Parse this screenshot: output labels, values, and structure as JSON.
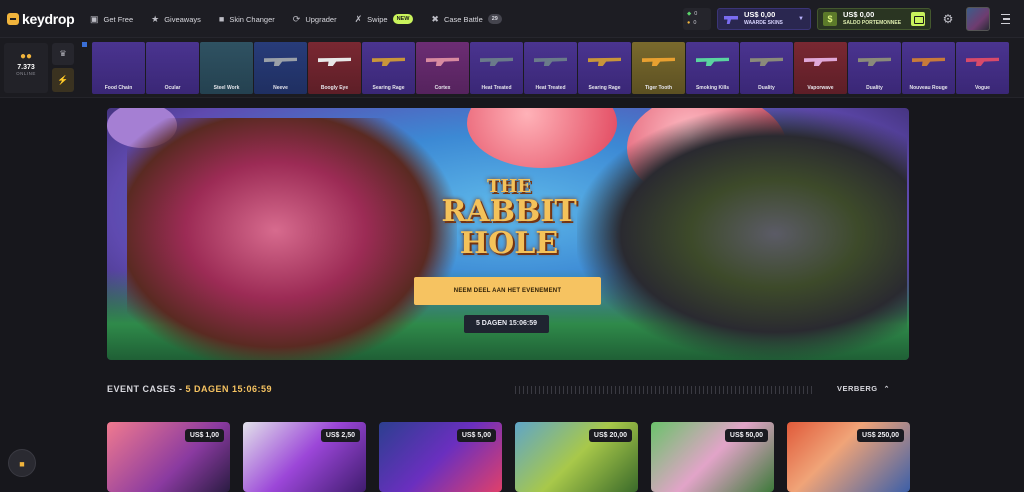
{
  "brand": {
    "name": "keydrop"
  },
  "nav": [
    {
      "label": "Get Free",
      "icon": "gift-icon"
    },
    {
      "label": "Giveaways",
      "icon": "giveaway-icon"
    },
    {
      "label": "Skin Changer",
      "icon": "skin-changer-icon"
    },
    {
      "label": "Upgrader",
      "icon": "upgrader-icon"
    },
    {
      "label": "Swipe",
      "icon": "swipe-icon",
      "badge": "NEW"
    },
    {
      "label": "Case Battle",
      "icon": "case-battle-icon",
      "badge": "29"
    }
  ],
  "gems": {
    "green": "0",
    "gold": "0"
  },
  "skins_balance": {
    "value": "US$ 0,00",
    "label": "WAARDE SKINS"
  },
  "wallet": {
    "value": "US$ 0,00",
    "label": "SALDO PORTEMONNEE"
  },
  "online": {
    "count": "7.373",
    "label": "ONLINE"
  },
  "live_drops": [
    {
      "name": "Food Chain",
      "rarity": "purple",
      "skin": false
    },
    {
      "name": "Ocular",
      "rarity": "purple",
      "skin": false
    },
    {
      "name": "Steel Work",
      "rarity": "steel",
      "skin": false
    },
    {
      "name": "Neeve",
      "rarity": "blue",
      "skin": true,
      "color": "#9aa0a8"
    },
    {
      "name": "Boogly Eye",
      "rarity": "red",
      "skin": true,
      "color": "#e8e8e8"
    },
    {
      "name": "Searing Rage",
      "rarity": "purple",
      "skin": true,
      "color": "#c8953a"
    },
    {
      "name": "Cortex",
      "rarity": "pink",
      "skin": true,
      "color": "#d88aa0"
    },
    {
      "name": "Heat Treated",
      "rarity": "purple",
      "skin": true,
      "color": "#6a7a8a"
    },
    {
      "name": "Heat Treated",
      "rarity": "purple",
      "skin": true,
      "color": "#6a7a8a"
    },
    {
      "name": "Searing Rage",
      "rarity": "purple",
      "skin": true,
      "color": "#c8953a"
    },
    {
      "name": "Tiger Tooth",
      "rarity": "gold",
      "skin": true,
      "color": "#e8a030"
    },
    {
      "name": "Smoking Kills",
      "rarity": "purple",
      "skin": true,
      "color": "#5ad4a0"
    },
    {
      "name": "Duality",
      "rarity": "purple",
      "skin": true,
      "color": "#8a8a7a"
    },
    {
      "name": "Vaporwave",
      "rarity": "red",
      "skin": true,
      "color": "#e0a8d8"
    },
    {
      "name": "Duality",
      "rarity": "purple",
      "skin": true,
      "color": "#8a8a7a"
    },
    {
      "name": "Nouveau Rouge",
      "rarity": "purple",
      "skin": true,
      "color": "#c87a3a"
    },
    {
      "name": "Vogue",
      "rarity": "purple",
      "skin": true,
      "color": "#d84a6a"
    }
  ],
  "banner": {
    "title_top": "THE",
    "title_main": "RABBIT HOLE",
    "cta": "NEEM DEEL AAN HET EVENEMENT",
    "timer": "5 DAGEN 15:06:59"
  },
  "event_section": {
    "title": "EVENT CASES -",
    "timer": "5 DAGEN 15:06:59",
    "hide_label": "VERBERG"
  },
  "cases": [
    {
      "price": "US$ 1,00"
    },
    {
      "price": "US$ 2,50"
    },
    {
      "price": "US$ 5,00"
    },
    {
      "price": "US$ 20,00"
    },
    {
      "price": "US$ 50,00"
    },
    {
      "price": "US$ 250,00"
    }
  ]
}
